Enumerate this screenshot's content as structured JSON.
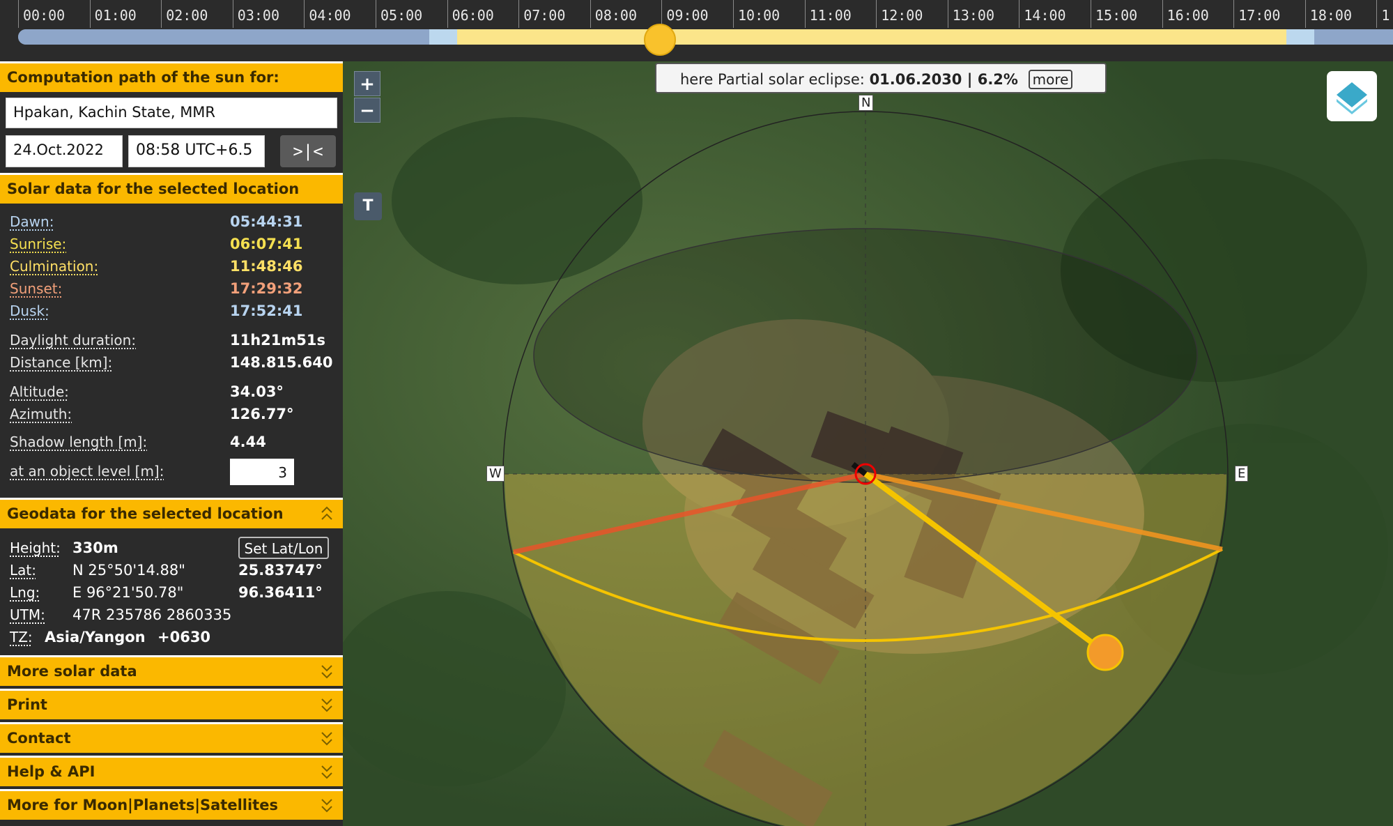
{
  "timeline": {
    "hours": [
      "00:00",
      "01:00",
      "02:00",
      "03:00",
      "04:00",
      "05:00",
      "06:00",
      "07:00",
      "08:00",
      "09:00",
      "10:00",
      "11:00",
      "12:00",
      "13:00",
      "14:00",
      "15:00",
      "16:00",
      "17:00",
      "18:00",
      "1"
    ],
    "current_position_fraction": 0.375
  },
  "panel": {
    "path_header": "Computation path of the sun for:",
    "location": "Hpakan, Kachin State, MMR",
    "date": "24.Oct.2022",
    "time": "08:58 UTC+6.5",
    "swap_label": ">|<",
    "solar_header": "Solar data for the selected location",
    "solar": {
      "dawn_label": "Dawn:",
      "dawn": "05:44:31",
      "sunrise_label": "Sunrise:",
      "sunrise": "06:07:41",
      "culmination_label": "Culmination:",
      "culmination": "11:48:46",
      "sunset_label": "Sunset:",
      "sunset": "17:29:32",
      "dusk_label": "Dusk:",
      "dusk": "17:52:41",
      "daylight_label": "Daylight duration:",
      "daylight": "11h21m51s",
      "distance_label": "Distance [km]:",
      "distance": "148.815.640",
      "altitude_label": "Altitude:",
      "altitude": "34.03°",
      "azimuth_label": "Azimuth:",
      "azimuth": "126.77°",
      "shadow_label": "Shadow length [m]:",
      "shadow": "4.44",
      "object_label": "at an object level [m]:",
      "object_level": "3"
    },
    "geo_header": "Geodata for the selected location",
    "geo": {
      "height_label": "Height:",
      "height": "330m",
      "set_latlon": "Set Lat/Lon",
      "lat_label": "Lat:",
      "lat_dms": "N 25°50'14.88\"",
      "lat_dec": "25.83747°",
      "lng_label": "Lng:",
      "lng_dms": "E 96°21'50.78\"",
      "lng_dec": "96.36411°",
      "utm_label": "UTM:",
      "utm": "47R 235786 2860335",
      "tz_label": "TZ:",
      "tz": "Asia/Yangon",
      "tz_offset": "+0630"
    },
    "sections": [
      "More solar data",
      "Print",
      "Contact",
      "Help & API",
      "More for Moon|Planets|Satellites"
    ]
  },
  "map": {
    "zoom_in": "+",
    "zoom_out": "−",
    "t_button": "T",
    "eclipse_prefix": "here Partial solar eclipse:",
    "eclipse_value": "01.06.2030 | 6.2%",
    "eclipse_more": "more",
    "compass": {
      "n": "N",
      "w": "W",
      "e": "E"
    }
  },
  "colors": {
    "accent": "#fbb800",
    "dawn": "#b8d4f0",
    "sunrise": "#f5e050",
    "culmination": "#ffe066",
    "sunset": "#f2a07a",
    "dusk": "#b8d4f0",
    "sunrise_line": "#e8552a",
    "sunset_line": "#f09420",
    "sun_direction": "#f5c400"
  }
}
